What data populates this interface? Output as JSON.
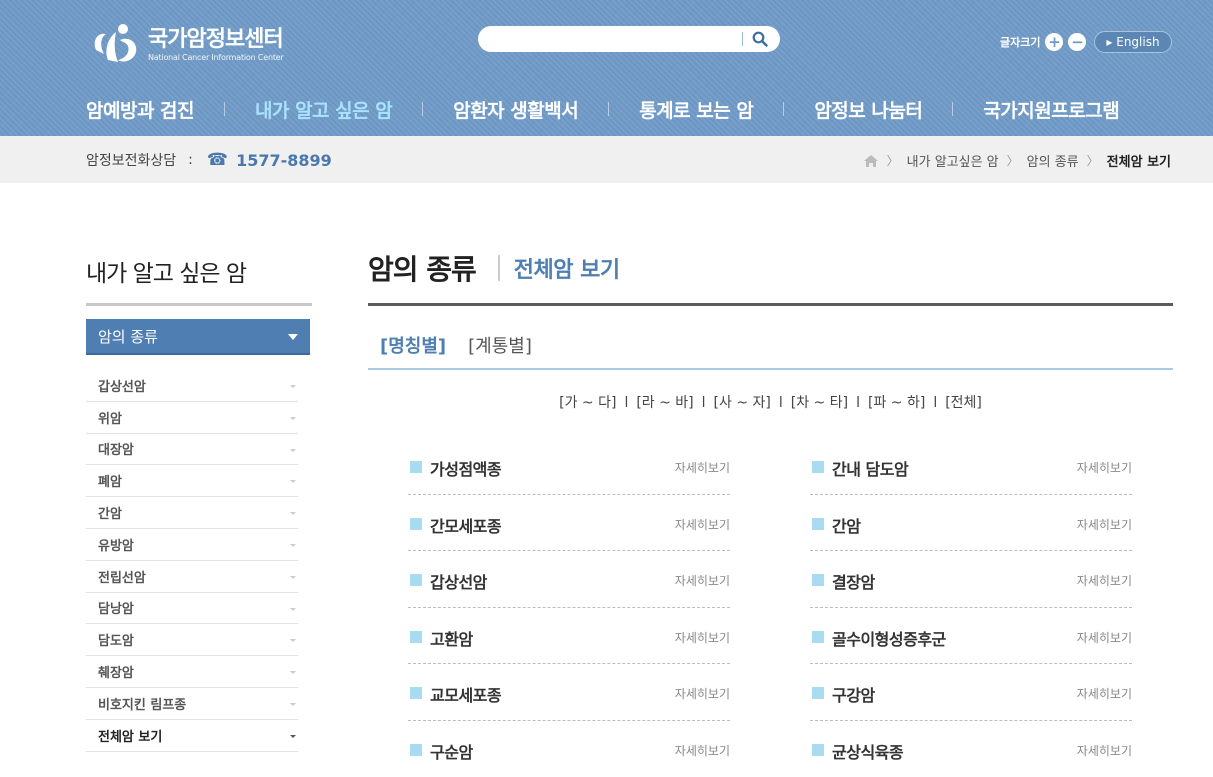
{
  "header": {
    "logo_ko": "국가암정보센터",
    "logo_en": "National Cancer Information Center",
    "search_placeholder": "",
    "font_size_label": "글자크기",
    "font_plus": "+",
    "font_minus": "−",
    "lang_label": "▸ English"
  },
  "gnb": [
    {
      "label": "암예방과 검진",
      "active": false
    },
    {
      "label": "내가 알고 싶은 암",
      "active": true
    },
    {
      "label": "암환자 생활백서",
      "active": false
    },
    {
      "label": "통계로 보는 암",
      "active": false
    },
    {
      "label": "암정보 나눔터",
      "active": false
    },
    {
      "label": "국가지원프로그램",
      "active": false
    }
  ],
  "subbar": {
    "tel_label": "암정보전화상담",
    "tel_colon": ":",
    "tel_number": "1577-8899",
    "breadcrumb": [
      "내가 알고싶은 암",
      "암의 종류",
      "전체암 보기"
    ]
  },
  "sidebar": {
    "title": "내가 알고 싶은 암",
    "active_menu": "암의 종류",
    "items": [
      "갑상선암",
      "위암",
      "대장암",
      "폐암",
      "간암",
      "유방암",
      "전립선암",
      "담낭암",
      "담도암",
      "췌장암",
      "비호지킨 림프종",
      "전체암 보기"
    ],
    "current_index": 11
  },
  "main": {
    "title": "암의 종류",
    "subtitle": "전체암 보기",
    "tabs": [
      "[명칭별]",
      "[계통별]"
    ],
    "active_tab": 0,
    "alpha": [
      "[가 ~ 다]",
      "[라 ~ 바]",
      "[사 ~ 자]",
      "[차 ~ 타]",
      "[파 ~ 하]",
      "[전체]"
    ],
    "alpha_sep": "l",
    "more_label": "자세히보기",
    "col1": [
      "가성점액종",
      "간모세포종",
      "갑상선암",
      "고환암",
      "교모세포종",
      "구순암"
    ],
    "col2": [
      "간내 담도암",
      "간암",
      "결장암",
      "골수이형성증후군",
      "구강암",
      "균상식육종"
    ]
  },
  "colors": {
    "header_bg": "#6f9ac6",
    "accent": "#4f7fb2",
    "active_nav": "#a9e3ff",
    "bullet": "#a9dcf0"
  }
}
